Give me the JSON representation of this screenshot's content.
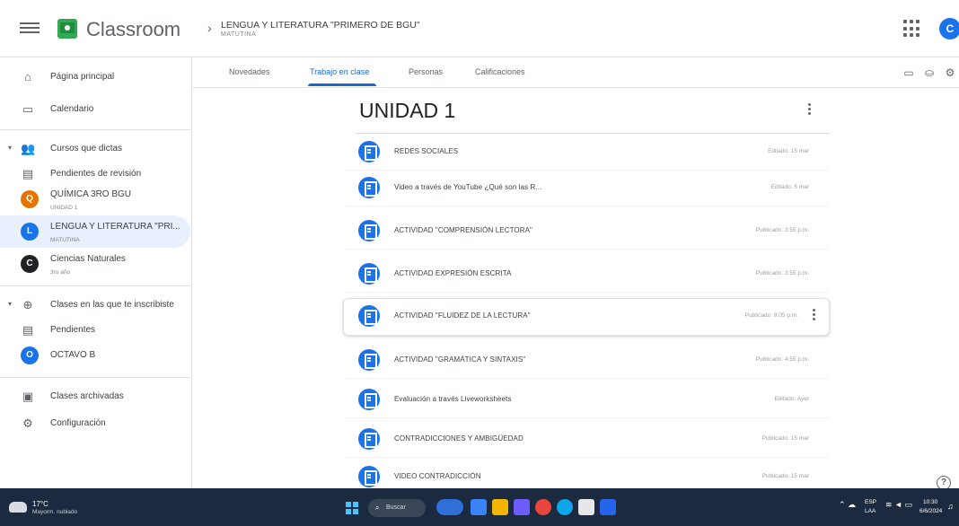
{
  "header": {
    "app_name": "Classroom",
    "breadcrumb_separator": "›",
    "course_title": "LENGUA Y LITERATURA \"PRIMERO DE BGU\"",
    "course_subtitle": "MATUTINA",
    "user_initial": "C"
  },
  "sidebar": {
    "home": "Página principal",
    "calendar": "Calendario",
    "teaching_section": "Cursos que dictas",
    "to_review": "Pendientes de revisión",
    "teaching_courses": [
      {
        "initial": "Q",
        "name": "QUÍMICA 3RO BGU",
        "sub": "UNIDAD 1",
        "color": "#e37400"
      },
      {
        "initial": "L",
        "name": "LENGUA Y LITERATURA \"PRI...",
        "sub": "MATUTINA",
        "color": "#1a73e8"
      },
      {
        "initial": "C",
        "name": "Ciencias Naturales",
        "sub": "3ro año",
        "color": "#202124"
      }
    ],
    "enrolled_section": "Clases en las que te inscribiste",
    "pending": "Pendientes",
    "enrolled_courses": [
      {
        "initial": "O",
        "name": "OCTAVO B",
        "color": "#1a73e8"
      }
    ],
    "archived": "Clases archivadas",
    "settings": "Configuración"
  },
  "tabs": {
    "stream": "Novedades",
    "classwork": "Trabajo en clase",
    "people": "Personas",
    "grades": "Calificaciones"
  },
  "topic": {
    "title": "UNIDAD 1"
  },
  "items": [
    {
      "title": "REDES SOCIALES",
      "date": "Editado: 15 mar"
    },
    {
      "title": "Video a través de YouTube ¿Qué son las R...",
      "date": "Editado: 5 mar"
    },
    {
      "title": "ACTIVIDAD \"COMPRENSIÓN LECTORA\"",
      "date": "Publicado: 3:55 p.m."
    },
    {
      "title": "ACTIVIDAD EXPRESIÓN ESCRITA",
      "date": "Publicado: 3:55 p.m."
    },
    {
      "title": "ACTIVIDAD \"FLUIDEZ DE LA LECTURA\"",
      "date": "Publicado: 9:05 p.m."
    },
    {
      "title": "ACTIVIDAD \"GRAMÁTICA Y SINTAXIS\"",
      "date": "Publicado: 4:55 p.m."
    },
    {
      "title": "Evaluación a través Liveworksheets",
      "date": "Editado: Ayer"
    },
    {
      "title": "CONTRADICCIONES Y AMBIGÜEDAD",
      "date": "Publicado: 15 mar"
    },
    {
      "title": "VIDEO CONTRADICCIÓN",
      "date": "Publicado: 15 mar"
    }
  ],
  "taskbar": {
    "weather_temp": "17°C",
    "weather_desc": "Mayorm. nublado",
    "search_placeholder": "Buscar",
    "lang_1": "ESP",
    "lang_2": "LAA",
    "time": "10:30",
    "date": "6/6/2024"
  }
}
